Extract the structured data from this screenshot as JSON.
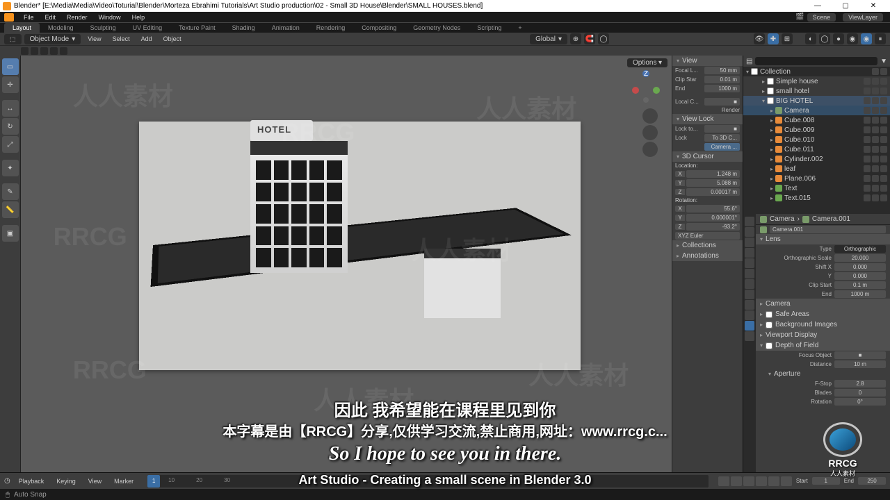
{
  "window": {
    "title": "Blender* [E:\\Media\\Media\\Video\\Toturial\\Blender\\Morteza Ebrahimi Tutorials\\Art Studio production\\02 - Small 3D House\\Blender\\SMALL HOUSES.blend]",
    "min": "—",
    "max": "▢",
    "close": "✕"
  },
  "topmenu": {
    "items": [
      "File",
      "Edit",
      "Render",
      "Window",
      "Help"
    ],
    "scene_label": "Scene",
    "viewlayer_label": "ViewLayer"
  },
  "tabs": [
    "Layout",
    "Modeling",
    "Sculpting",
    "UV Editing",
    "Texture Paint",
    "Shading",
    "Animation",
    "Rendering",
    "Compositing",
    "Geometry Nodes",
    "Scripting",
    "+"
  ],
  "header": {
    "mode": "Object Mode",
    "menus": [
      "View",
      "Select",
      "Add",
      "Object"
    ],
    "orientation": "Global"
  },
  "options_label": "Options",
  "npanel": {
    "view": "View",
    "focal": {
      "label": "Focal L...",
      "val": "50 mm"
    },
    "clip_start": {
      "label": "Clip Star",
      "val": "0.01 m"
    },
    "clip_end": {
      "label": "End",
      "val": "1000 m"
    },
    "local_c": {
      "label": "Local C..."
    },
    "render": "Render",
    "viewlock": "View Lock",
    "lockto": "Lock to...",
    "lock_label": "Lock",
    "to3dc": "To 3D C...",
    "camera_lock": "Camera ...",
    "cursor": "3D Cursor",
    "location": "Location:",
    "loc_x": "1.248 m",
    "loc_y": "5.088 m",
    "loc_z": "0.00017 m",
    "rotation": "Rotation:",
    "rot_x": "55.6°",
    "rot_y": "0.000001°",
    "rot_z": "-93.2°",
    "rot_mode": "XYZ Euler",
    "collections": "Collections",
    "annotations": "Annotations"
  },
  "outliner": {
    "root": "Collection",
    "items": [
      {
        "name": "Simple house",
        "type": "collection",
        "depth": 1
      },
      {
        "name": "small hotel",
        "type": "collection",
        "depth": 1
      },
      {
        "name": "BIG HOTEL",
        "type": "collection",
        "depth": 1,
        "expanded": true,
        "sel": false,
        "highlight": true
      },
      {
        "name": "Camera",
        "type": "camera",
        "depth": 2,
        "sel": true
      },
      {
        "name": "Cube.008",
        "type": "mesh",
        "depth": 2
      },
      {
        "name": "Cube.009",
        "type": "mesh",
        "depth": 2
      },
      {
        "name": "Cube.010",
        "type": "mesh",
        "depth": 2
      },
      {
        "name": "Cube.011",
        "type": "mesh",
        "depth": 2
      },
      {
        "name": "Cylinder.002",
        "type": "mesh",
        "depth": 2
      },
      {
        "name": "leaf",
        "type": "mesh",
        "depth": 2
      },
      {
        "name": "Plane.006",
        "type": "mesh",
        "depth": 2
      },
      {
        "name": "Text",
        "type": "text",
        "depth": 2
      },
      {
        "name": "Text.015",
        "type": "text",
        "depth": 2
      }
    ]
  },
  "properties": {
    "bc1": "Camera",
    "bc2": "Camera.001",
    "name": "Camera.001",
    "lens_h": "Lens",
    "type_label": "Type",
    "type_val": "Orthographic",
    "ortho_scale_label": "Orthographic Scale",
    "ortho_scale_val": "20.000",
    "shiftx_label": "Shift X",
    "shiftx_val": "0.000",
    "shifty_label": "Y",
    "shifty_val": "0.000",
    "clipstart_label": "Clip Start",
    "clipstart_val": "0.1 m",
    "clipend_label": "End",
    "clipend_val": "1000 m",
    "camera_h": "Camera",
    "safe_h": "Safe Areas",
    "bg_h": "Background Images",
    "vp_h": "Viewport Display",
    "dof_h": "Depth of Field",
    "focus_label": "Focus Object",
    "distance_label": "Distance",
    "distance_val": "10 m",
    "aperture_h": "Aperture",
    "fstop_label": "F-Stop",
    "fstop_val": "2.8",
    "blades_label": "Blades",
    "blades_val": "0",
    "rotation_label": "Rotation",
    "rotation_val": "0°"
  },
  "timeline": {
    "menus": [
      "Playback",
      "Keying",
      "View",
      "Marker"
    ],
    "start_label": "Start",
    "start_val": "1",
    "end_label": "End",
    "end_val": "250",
    "cur": "1",
    "ticks": [
      "10",
      "20",
      "30"
    ]
  },
  "status": {
    "text": "Auto Snap"
  },
  "hotel_sign": "HOTEL",
  "subtitles": {
    "l1": "因此 我希望能在课程里见到你",
    "l2": "本字幕是由【RRCG】分享,仅供学习交流,禁止商用,网址：www.rrcg.c...",
    "l3": "So I hope to see you in there.",
    "l4": "Art Studio - Creating a small scene in Blender 3.0"
  },
  "logo": {
    "main": "RRCG",
    "sub": "人人素材"
  },
  "icons": {
    "chevron_down": "▾",
    "search": "🔍",
    "filter": "⚙"
  }
}
